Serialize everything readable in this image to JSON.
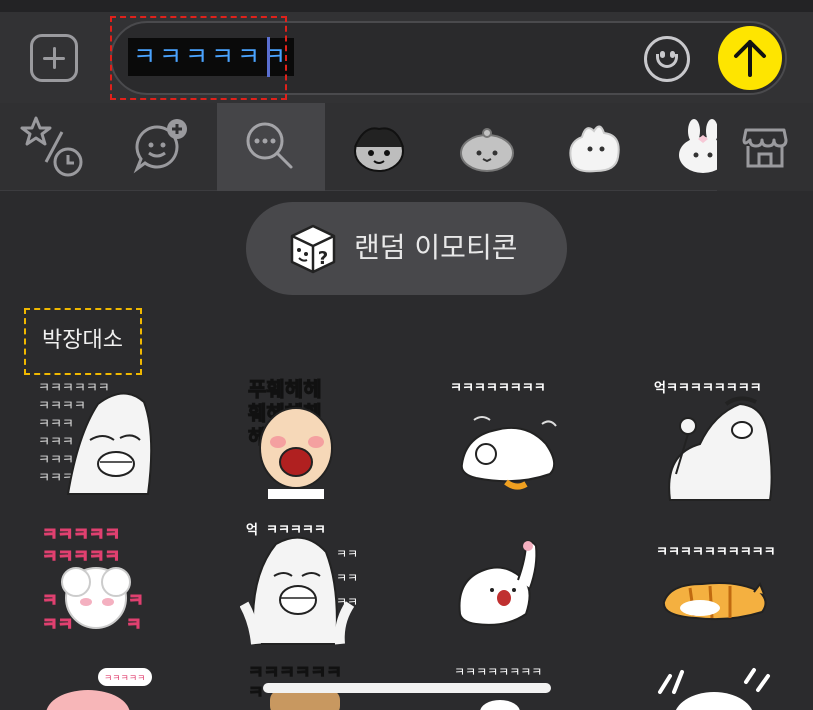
{
  "message": {
    "text": "ㅋㅋㅋㅋㅋㅋ"
  },
  "toolbar": {
    "attach_icon": "plus-icon",
    "emoji_icon": "emoji-face-icon",
    "send_icon": "arrow-up-icon",
    "send_color": "#fee500"
  },
  "tabs": [
    {
      "icon": "favorites-recent-icon"
    },
    {
      "icon": "emoticon-add-icon"
    },
    {
      "icon": "search-icon",
      "active": true
    },
    {
      "icon": "sticker-pack-girl"
    },
    {
      "icon": "sticker-pack-bear"
    },
    {
      "icon": "sticker-pack-blob"
    },
    {
      "icon": "sticker-pack-rabbit"
    },
    {
      "icon": "store-icon"
    }
  ],
  "random_button": {
    "label": "랜덤 이모티콘",
    "icon": "random-dice-icon"
  },
  "section": {
    "title": "박장대소"
  },
  "stickers": {
    "r1c1": "ㅋㅋㅋㅋㅋㅋ",
    "r1c2": "푸훼헤헤",
    "r1c3": "ㅋㅋㅋㅋㅋㅋㅋㅋ",
    "r1c4": "억ㅋㅋㅋㅋㅋㅋㅋㅋ",
    "r2c1": "ㅋㅋㅋㅋㅋ",
    "r2c2": "ㅋㅋㅋㅋㅋ",
    "r3c1": "ㅋㅋㅋㅋㅋ",
    "r3c2": "ㅋㅋㅋㅋㅋㅋ",
    "r3c3": "ㅋㅋㅋㅋㅋㅋㅋㅋ"
  },
  "colors": {
    "background": "#2b2b2d",
    "accent_yellow": "#fee500",
    "highlight_red": "#e0211b",
    "highlight_yellow": "#f0b800"
  }
}
